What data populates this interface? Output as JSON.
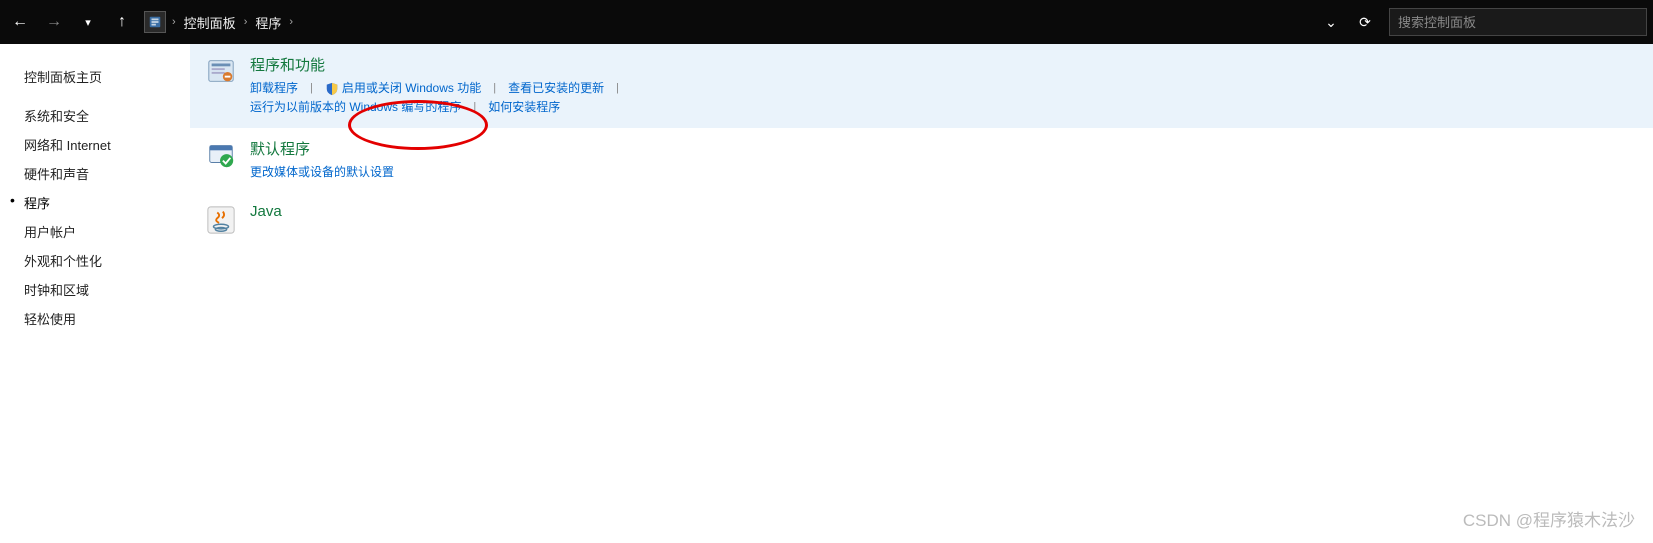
{
  "titlebar": {
    "breadcrumb": [
      "控制面板",
      "程序"
    ],
    "search_placeholder": "搜索控制面板"
  },
  "sidebar": {
    "items": [
      {
        "label": "控制面板主页",
        "active": false
      },
      {
        "label": "系统和安全",
        "active": false
      },
      {
        "label": "网络和 Internet",
        "active": false
      },
      {
        "label": "硬件和声音",
        "active": false
      },
      {
        "label": "程序",
        "active": true
      },
      {
        "label": "用户帐户",
        "active": false
      },
      {
        "label": "外观和个性化",
        "active": false
      },
      {
        "label": "时钟和区域",
        "active": false
      },
      {
        "label": "轻松使用",
        "active": false
      }
    ]
  },
  "sections": [
    {
      "title": "程序和功能",
      "highlight": true,
      "icon": "programs",
      "rows": [
        [
          {
            "text": "卸载程序",
            "shield": false
          },
          {
            "text": "启用或关闭 Windows 功能",
            "shield": true
          },
          {
            "text": "查看已安装的更新",
            "shield": false
          }
        ],
        [
          {
            "text": "运行为以前版本的 Windows 编写的程序",
            "shield": false
          },
          {
            "text": "如何安装程序",
            "shield": false
          }
        ]
      ]
    },
    {
      "title": "默认程序",
      "highlight": false,
      "icon": "defaults",
      "rows": [
        [
          {
            "text": "更改媒体或设备的默认设置",
            "shield": false
          }
        ]
      ]
    },
    {
      "title": "Java",
      "highlight": false,
      "icon": "java",
      "rows": []
    }
  ],
  "watermark": "CSDN @程序猿木法沙"
}
